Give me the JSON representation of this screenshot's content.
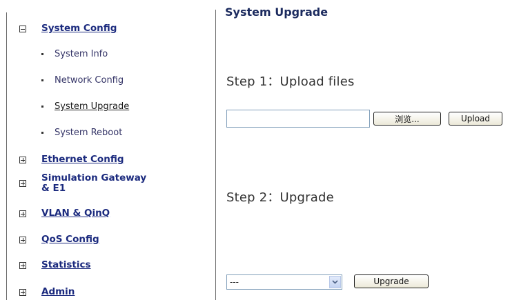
{
  "page_title": "System Upgrade",
  "sidebar": {
    "groups": [
      {
        "label": "System Config",
        "expanded": true,
        "sub_items": [
          {
            "label": "System Info"
          },
          {
            "label": "Network Config"
          },
          {
            "label": "System Upgrade",
            "active": true
          },
          {
            "label": "System Reboot"
          }
        ]
      },
      {
        "label": "Ethernet Config",
        "expanded": false
      },
      {
        "label": "Simulation Gateway",
        "label_line2": "& E1",
        "expanded": false
      },
      {
        "label": "VLAN & QinQ",
        "expanded": false
      },
      {
        "label": "QoS Config",
        "expanded": false
      },
      {
        "label": "Statistics",
        "expanded": false
      },
      {
        "label": "Admin",
        "expanded": false
      }
    ]
  },
  "step1": {
    "title": "Step 1：Upload files",
    "file_input_value": "",
    "browse_label": "浏览...",
    "upload_label": "Upload"
  },
  "step2": {
    "title": "Step 2：Upgrade",
    "select_value": "---",
    "upgrade_label": "Upgrade"
  }
}
